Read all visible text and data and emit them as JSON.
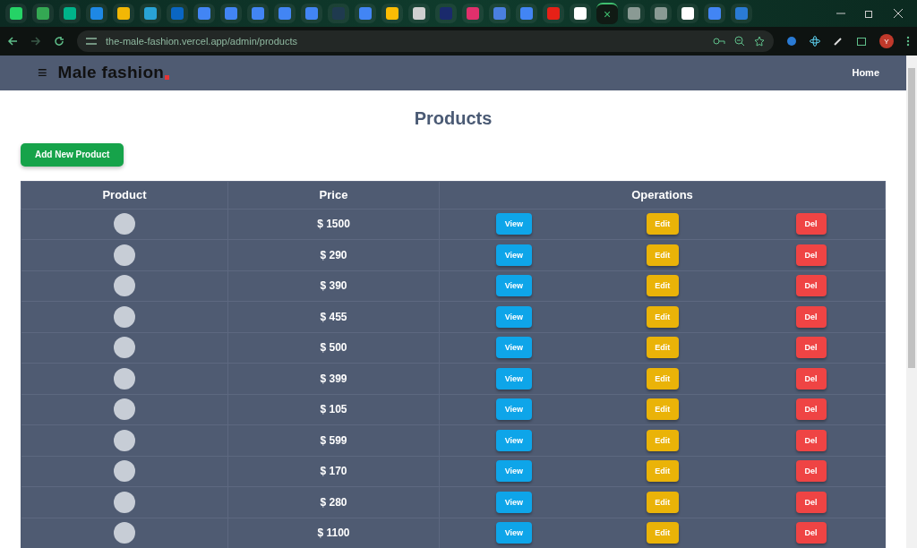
{
  "browser": {
    "tabs": [
      {
        "selected": false,
        "color": "#25d366"
      },
      {
        "selected": false,
        "color": "#34a853"
      },
      {
        "selected": false,
        "color": "#00b38a"
      },
      {
        "selected": false,
        "color": "#1e88e5"
      },
      {
        "selected": false,
        "color": "#f2b705"
      },
      {
        "selected": false,
        "color": "#29a3d6"
      },
      {
        "selected": false,
        "color": "#0a66c2"
      },
      {
        "selected": false,
        "color": "#4285f4"
      },
      {
        "selected": false,
        "color": "#4285f4"
      },
      {
        "selected": false,
        "color": "#4285f4"
      },
      {
        "selected": false,
        "color": "#4285f4"
      },
      {
        "selected": false,
        "color": "#4285f4"
      },
      {
        "selected": false,
        "color": "#1f3a4f"
      },
      {
        "selected": false,
        "color": "#4285f4"
      },
      {
        "selected": false,
        "color": "#fbbc04"
      },
      {
        "selected": false,
        "color": "#d0d0d0"
      },
      {
        "selected": false,
        "color": "#1a2a6c"
      },
      {
        "selected": false,
        "color": "#e1306c"
      },
      {
        "selected": false,
        "color": "#4a7fe0"
      },
      {
        "selected": false,
        "color": "#4285f4"
      },
      {
        "selected": false,
        "color": "#e62117"
      },
      {
        "selected": false,
        "color": "#ffffff"
      },
      {
        "selected": true
      },
      {
        "selected": false,
        "color": "#8a9a94"
      },
      {
        "selected": false,
        "color": "#8a9a94"
      },
      {
        "selected": false,
        "color": "#ffffff"
      },
      {
        "selected": false,
        "color": "#4285f4"
      },
      {
        "selected": false,
        "color": "#2a7bd4"
      }
    ],
    "close_glyph": "×",
    "url": "the-male-fashion.vercel.app/admin/products",
    "profile_initial": "Y"
  },
  "navbar": {
    "menu_glyph": "≡",
    "logo": "Male fashion",
    "home_link": "Home"
  },
  "page": {
    "title": "Products",
    "add_button": "Add New Product"
  },
  "table": {
    "columns": [
      "Product",
      "Price",
      "Operations"
    ],
    "rows": [
      {
        "price": "$ 1500",
        "actions": [
          "View",
          "Edit",
          "Del"
        ]
      },
      {
        "price": "$ 290",
        "actions": [
          "View",
          "Edit",
          "Del"
        ]
      },
      {
        "price": "$ 390",
        "actions": [
          "View",
          "Edit",
          "Del"
        ]
      },
      {
        "price": "$ 455",
        "actions": [
          "View",
          "Edit",
          "Del"
        ]
      },
      {
        "price": "$ 500",
        "actions": [
          "View",
          "Edit",
          "Del"
        ]
      },
      {
        "price": "$ 399",
        "actions": [
          "View",
          "Edit",
          "Del"
        ]
      },
      {
        "price": "$ 105",
        "actions": [
          "View",
          "Edit",
          "Del"
        ]
      },
      {
        "price": "$ 599",
        "actions": [
          "View",
          "Edit",
          "Del"
        ]
      },
      {
        "price": "$ 170",
        "actions": [
          "View",
          "Edit",
          "Del"
        ]
      },
      {
        "price": "$ 280",
        "actions": [
          "View",
          "Edit",
          "Del"
        ]
      },
      {
        "price": "$ 1100",
        "actions": [
          "View",
          "Edit",
          "Del"
        ]
      }
    ]
  }
}
